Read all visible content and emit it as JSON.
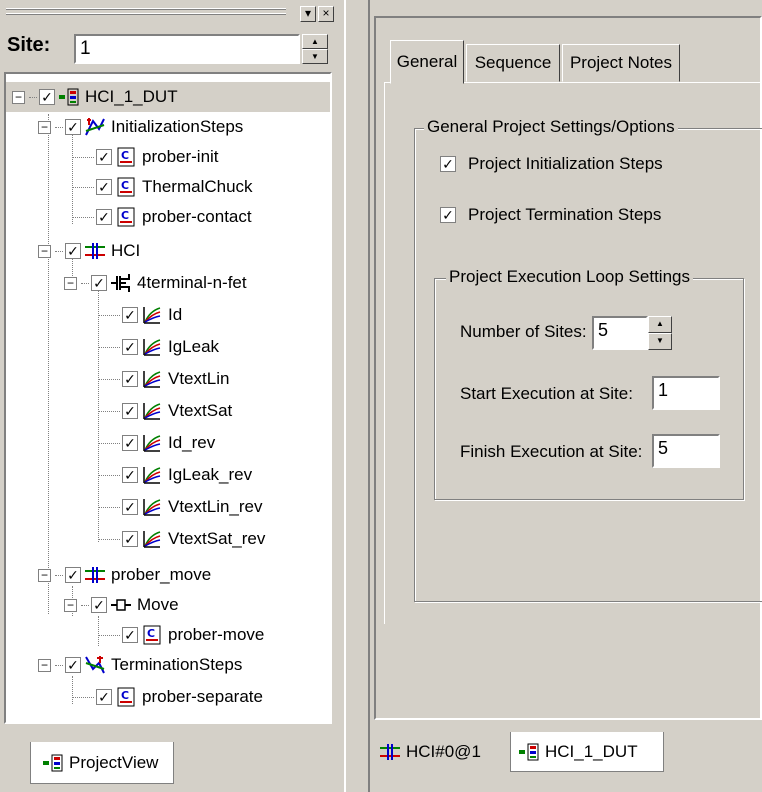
{
  "site": {
    "label": "Site:",
    "value": "1"
  },
  "tree": [
    {
      "label": "HCI_1_DUT",
      "icon": "project-icon",
      "checked": true
    },
    {
      "label": "InitializationSteps",
      "icon": "init-steps-icon",
      "checked": true
    },
    {
      "label": "prober-init",
      "icon": "script-icon",
      "checked": true
    },
    {
      "label": "ThermalChuck",
      "icon": "script-icon",
      "checked": true
    },
    {
      "label": "prober-contact",
      "icon": "script-icon",
      "checked": true
    },
    {
      "label": "HCI",
      "icon": "subsite-icon",
      "checked": true
    },
    {
      "label": "4terminal-n-fet",
      "icon": "device-icon",
      "checked": true
    },
    {
      "label": "Id",
      "icon": "test-icon",
      "checked": true
    },
    {
      "label": "IgLeak",
      "icon": "test-icon",
      "checked": true
    },
    {
      "label": "VtextLin",
      "icon": "test-icon",
      "checked": true
    },
    {
      "label": "VtextSat",
      "icon": "test-icon",
      "checked": true
    },
    {
      "label": "Id_rev",
      "icon": "test-icon",
      "checked": true
    },
    {
      "label": "IgLeak_rev",
      "icon": "test-icon",
      "checked": true
    },
    {
      "label": "VtextLin_rev",
      "icon": "test-icon",
      "checked": true
    },
    {
      "label": "VtextSat_rev",
      "icon": "test-icon",
      "checked": true
    },
    {
      "label": "prober_move",
      "icon": "subsite-icon",
      "checked": true
    },
    {
      "label": "Move",
      "icon": "move-icon",
      "checked": true
    },
    {
      "label": "prober-move",
      "icon": "script-icon",
      "checked": true
    },
    {
      "label": "TerminationSteps",
      "icon": "term-steps-icon",
      "checked": true
    },
    {
      "label": "prober-separate",
      "icon": "script-icon",
      "checked": true
    }
  ],
  "left_tab": {
    "label": "ProjectView"
  },
  "tabs": [
    {
      "label": "General"
    },
    {
      "label": "Sequence"
    },
    {
      "label": "Project Notes"
    }
  ],
  "general": {
    "group_title": "General Project Settings/Options",
    "init_steps_label": "Project Initialization Steps",
    "init_steps_checked": true,
    "term_steps_label": "Project Termination Steps",
    "term_steps_checked": true,
    "loop_group_title": "Project Execution Loop Settings",
    "num_sites_label": "Number of Sites:",
    "num_sites_value": "5",
    "start_site_label": "Start Execution at Site:",
    "start_site_value": "1",
    "finish_site_label": "Finish Execution at Site:",
    "finish_site_value": "5"
  },
  "bottom_tabs": [
    {
      "label": "HCI#0@1",
      "icon": "subsite-icon"
    },
    {
      "label": "HCI_1_DUT",
      "icon": "project-icon"
    }
  ],
  "colors": {
    "accent_red": "#cc0000",
    "accent_blue": "#0000cc",
    "accent_green": "#008000"
  }
}
